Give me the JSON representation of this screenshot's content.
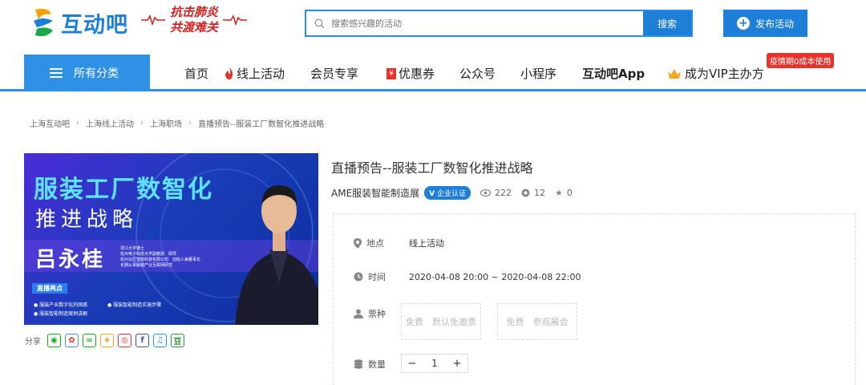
{
  "header": {
    "logo_text": "互动吧",
    "campaign_line1": "抗击肺炎",
    "campaign_line2": "共渡难关",
    "search_placeholder": "搜索感兴趣的活动",
    "search_button": "搜索",
    "publish_button": "发布活动"
  },
  "nav": {
    "all_categories": "所有分类",
    "items": [
      "首页",
      "线上活动",
      "会员专享",
      "优惠券",
      "公众号",
      "小程序",
      "互动吧App",
      "成为VIP主办方"
    ],
    "vip_tag": "疫情期0成本使用"
  },
  "breadcrumb": [
    "上海互动吧",
    "上海线上活动",
    "上海职场",
    "直播预告--服装工厂数智化推进战略"
  ],
  "poster": {
    "title1": "服装工厂数智化",
    "title2": "推进战略",
    "speaker": "吕永桂",
    "bio": [
      "浙江大学博士",
      "杭州电子科技大学副教授　硕导",
      "杭州云匠智能科技有限公司　创始人兼董事长",
      "长期从事服装产业互联网研究"
    ],
    "highlight_label": "直播亮点",
    "bullets": [
      "服装产业数字化的困惑",
      "服装智能制造实施步骤",
      "服装智能制造案例讲解"
    ]
  },
  "share": {
    "label": "分享"
  },
  "event": {
    "title": "直播预告--服装工厂数智化推进战略",
    "organizer": "AME服装智能制造展",
    "verified_badge": "企业认证",
    "views": "222",
    "comments": "12",
    "stars": "0",
    "location_label": "地点",
    "location": "线上活动",
    "time_label": "时间",
    "time": "2020-04-08 20:00 ~ 2020-04-08 22:00",
    "ticket_label": "票种",
    "tickets": [
      "免费　默认免邀票",
      "免费　参观展会"
    ],
    "qty_label": "数量",
    "qty": "1"
  },
  "colors": {
    "brand": "#1e7fd8",
    "nav_blue": "#2f91e6",
    "alert_red": "#d81e1e"
  }
}
